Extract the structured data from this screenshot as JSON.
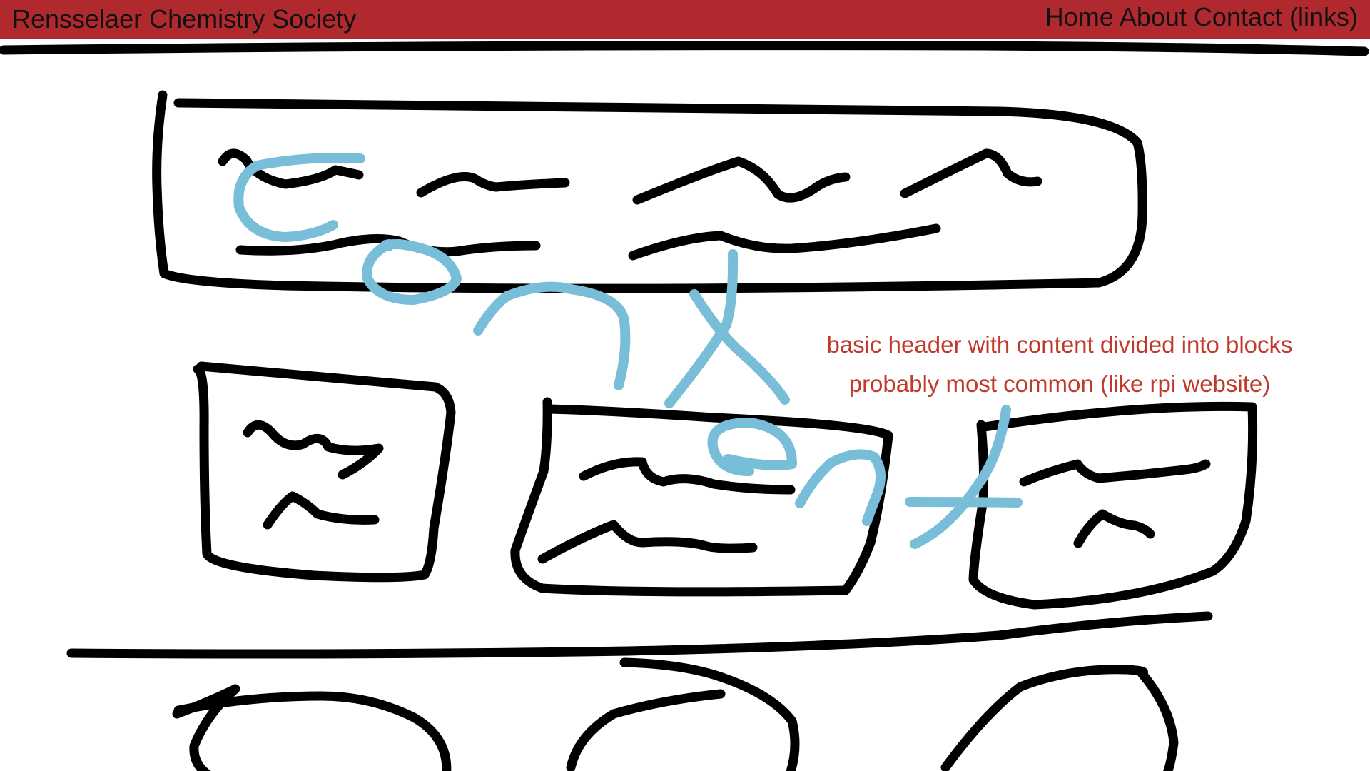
{
  "header": {
    "site_title": "Rensselaer Chemistry Society",
    "nav": {
      "home": "Home",
      "about": "About",
      "contact": "Contact",
      "links_note": "(links)"
    }
  },
  "annotation": {
    "line1": "basic header with content divided into blocks",
    "line2": "probably most common (like rpi website)"
  },
  "colors": {
    "header_red": "#b0292e",
    "sketch_ink": "#000000",
    "sketch_blue": "#79bed8",
    "annotation_red": "#c0392b"
  }
}
